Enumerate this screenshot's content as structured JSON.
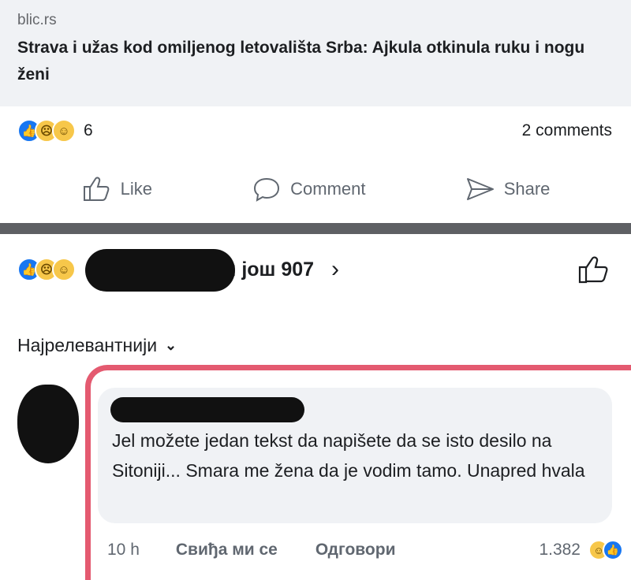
{
  "post": {
    "link_domain": "blic.rs",
    "link_title": "Strava i užas kod omiljenog letovališta Srba: Ajkula otkinula ruku i nogu ženi",
    "reaction_count": "6",
    "comments_count": "2 comments",
    "reaction_icons": [
      "like-icon",
      "sad-icon",
      "haha-icon"
    ]
  },
  "actions": {
    "like": "Like",
    "comment": "Comment",
    "share": "Share"
  },
  "comments_panel": {
    "reactors_text": "и још 907",
    "sort_label": "Најрелевантнији",
    "comment": {
      "text": "Jel možete jedan tekst da napišete da se isto desilo na Sitoniji... Smara me žena da je vodim tamo. Unapred hvala",
      "time": "10 h",
      "like_label": "Свиђа ми се",
      "reply_label": "Одговори",
      "reaction_count": "1.382"
    }
  },
  "colors": {
    "accent": "#1877f2",
    "highlight_outline": "#e45a70",
    "band": "#5e6064"
  }
}
